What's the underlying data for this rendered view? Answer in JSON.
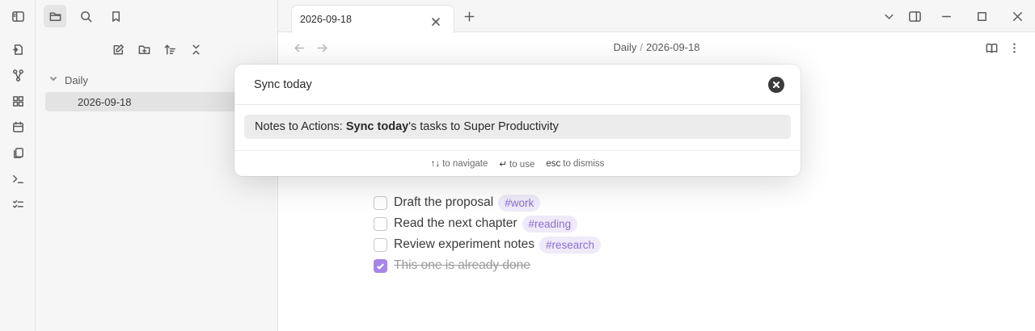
{
  "sidebar": {
    "folder": "Daily",
    "file": "2026-09-18"
  },
  "tab": {
    "title": "2026-09-18"
  },
  "breadcrumb": {
    "folder": "Daily",
    "separator": "/",
    "file": "2026-09-18"
  },
  "tasks": [
    {
      "text": "Draft the proposal",
      "tag": "#work",
      "checked": false
    },
    {
      "text": "Read the next chapter",
      "tag": "#reading",
      "checked": false
    },
    {
      "text": "Review experiment notes",
      "tag": "#research",
      "checked": false
    },
    {
      "text": "This one is already done",
      "tag": "",
      "checked": true
    }
  ],
  "palette": {
    "query": "Sync today",
    "suggestion": {
      "prefix": "Notes to Actions: ",
      "highlight": "Sync today",
      "suffix": "'s tasks to Super Productivity"
    },
    "hints": [
      {
        "key": "↑↓",
        "label": "to navigate"
      },
      {
        "key": "↵",
        "label": "to use"
      },
      {
        "key": "esc",
        "label": "to dismiss"
      }
    ]
  },
  "colors": {
    "accent": "#a686e6",
    "tag_bg": "#efeaf9",
    "tag_text": "#8b6fd4"
  }
}
